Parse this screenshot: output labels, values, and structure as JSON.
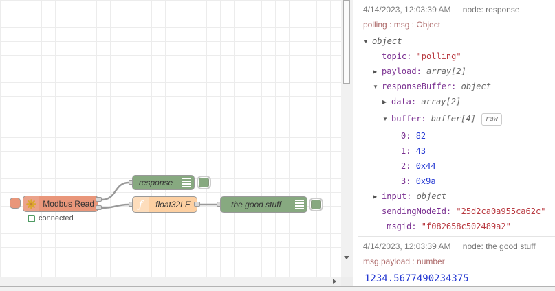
{
  "flow": {
    "modbus_node": {
      "label": "Modbus Read",
      "status": "connected"
    },
    "response_node": {
      "label": "response"
    },
    "function_node": {
      "label": "float32LE",
      "icon_glyph": "ƒ"
    },
    "goodstuff_node": {
      "label": "the good stuff"
    }
  },
  "debug_panel": {
    "raw_button_label": "raw",
    "messages": [
      {
        "timestamp": "4/14/2023, 12:03:39 AM",
        "node": "node: response",
        "meta": "polling : msg : Object",
        "tree": [
          {
            "level": 0,
            "expander": "down",
            "key": "",
            "value": "object",
            "type": "root"
          },
          {
            "level": 1,
            "expander": "none",
            "key": "topic",
            "value": "\"polling\"",
            "type": "string"
          },
          {
            "level": 1,
            "expander": "right",
            "key": "payload",
            "value": "array[2]",
            "type": "type"
          },
          {
            "level": 1,
            "expander": "down",
            "key": "responseBuffer",
            "value": "object",
            "type": "type"
          },
          {
            "level": 2,
            "expander": "right",
            "key": "data",
            "value": "array[2]",
            "type": "type"
          },
          {
            "level": 2,
            "expander": "down",
            "key": "buffer",
            "value": "buffer[4]",
            "type": "type",
            "raw": true
          },
          {
            "level": 3,
            "expander": "none",
            "key": "0",
            "value": "82",
            "type": "number"
          },
          {
            "level": 3,
            "expander": "none",
            "key": "1",
            "value": "43",
            "type": "number"
          },
          {
            "level": 3,
            "expander": "none",
            "key": "2",
            "value": "0x44",
            "type": "number"
          },
          {
            "level": 3,
            "expander": "none",
            "key": "3",
            "value": "0x9a",
            "type": "number"
          },
          {
            "level": 1,
            "expander": "right",
            "key": "input",
            "value": "object",
            "type": "type"
          },
          {
            "level": 1,
            "expander": "none",
            "key": "sendingNodeId",
            "value": "\"25d2ca0a955ca62c\"",
            "type": "string"
          },
          {
            "level": 1,
            "expander": "none",
            "key": "_msgid",
            "value": "\"f082658c502489a2\"",
            "type": "string"
          }
        ]
      },
      {
        "timestamp": "4/14/2023, 12:03:39 AM",
        "node": "node: the good stuff",
        "meta": "msg.payload : number",
        "value": "1234.5677490234375"
      }
    ]
  },
  "colors": {
    "debug_node_green": "#87a980",
    "function_node_orange": "#fdd0a2",
    "modbus_node_salmon": "#e9967a",
    "string_red": "#b8383f",
    "number_blue": "#2438d2",
    "key_purple": "#792e90",
    "meta_rose": "#ad6a6a",
    "status_green": "#4f9a63",
    "wire_gray": "#999999"
  }
}
